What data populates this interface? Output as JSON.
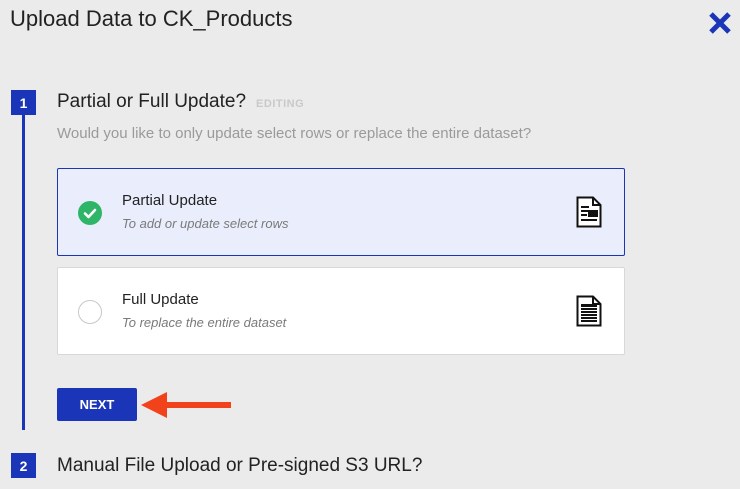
{
  "dialog": {
    "title": "Upload Data to CK_Products"
  },
  "steps": [
    {
      "number": "1",
      "title": "Partial or Full Update?",
      "status": "EDITING",
      "question": "Would you like to only update select rows or replace the entire dataset?",
      "options": [
        {
          "label": "Partial Update",
          "description": "To add or update select rows",
          "selected": true
        },
        {
          "label": "Full Update",
          "description": "To replace the entire dataset",
          "selected": false
        }
      ],
      "next_label": "NEXT"
    },
    {
      "number": "2",
      "title": "Manual File Upload or Pre-signed S3 URL?"
    }
  ],
  "colors": {
    "accent": "#1a35b8",
    "success": "#2eb567",
    "annotation_arrow": "#f2421b"
  },
  "icons": {
    "close": "close-icon",
    "check": "check-icon",
    "partial_doc": "partial-document-icon",
    "full_doc": "full-document-icon",
    "arrow": "pointer-arrow-icon"
  }
}
